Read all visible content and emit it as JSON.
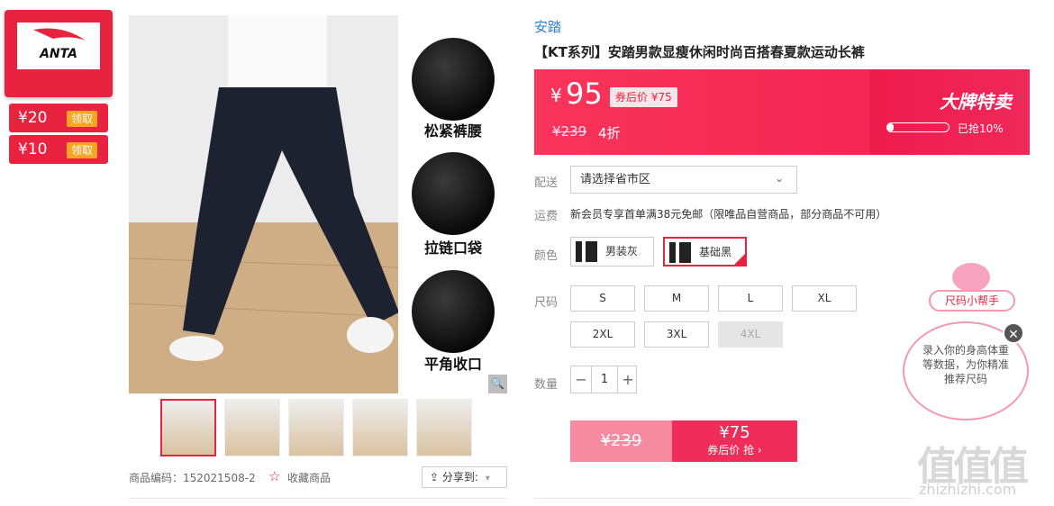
{
  "brand_badge": {
    "logo_text": "ANTA"
  },
  "coupons": [
    {
      "amount": "¥20",
      "action": "领取"
    },
    {
      "amount": "¥10",
      "action": "领取"
    }
  ],
  "detail_features": [
    "松紧裤腰",
    "拉链口袋",
    "平角收口"
  ],
  "thumbnails_count": 5,
  "meta": {
    "product_code": "商品编码：152021508-2",
    "favorite_label": "收藏商品",
    "share_label": "分享到:"
  },
  "product": {
    "brand": "安踏",
    "title": "【KT系列】安踏男款显瘦休闲时尚百搭春夏款运动长裤"
  },
  "price": {
    "currency": "¥",
    "current": "95",
    "coupon_tag": "券后价 ¥75",
    "original": "¥239",
    "discount": "4折",
    "sale_title": "大牌特卖",
    "sold_percent": 0.1,
    "sold_text": "已抢10%"
  },
  "delivery": {
    "label": "配送",
    "placeholder": "请选择省市区"
  },
  "shipping": {
    "label": "运费",
    "text": "新会员专享首单满38元免邮（限唯品自营商品，部分商品不可用）"
  },
  "colors": {
    "label": "颜色",
    "options": [
      {
        "name": "男装灰",
        "selected": false
      },
      {
        "name": "基础黑",
        "selected": true
      }
    ]
  },
  "sizes": {
    "label": "尺码",
    "options": [
      "S",
      "M",
      "L",
      "XL",
      "2XL",
      "3XL",
      "4XL"
    ],
    "disabled": [
      "4XL"
    ]
  },
  "quantity": {
    "label": "数量",
    "value": "1",
    "minus": "−",
    "plus": "+"
  },
  "buy": {
    "original_price": "¥239",
    "after_price": "¥75",
    "after_label": "券后价 抢 ›"
  },
  "helper": {
    "label": "尺码小帮手",
    "text": "录入你的身高体重等数据，为你精准推荐尺码",
    "close": "✕"
  },
  "watermark": {
    "logo": "值值值",
    "url": "zhizhizhi.com"
  },
  "colors_theme": {
    "accent": "#e8233f",
    "link": "#2d7fd3"
  }
}
